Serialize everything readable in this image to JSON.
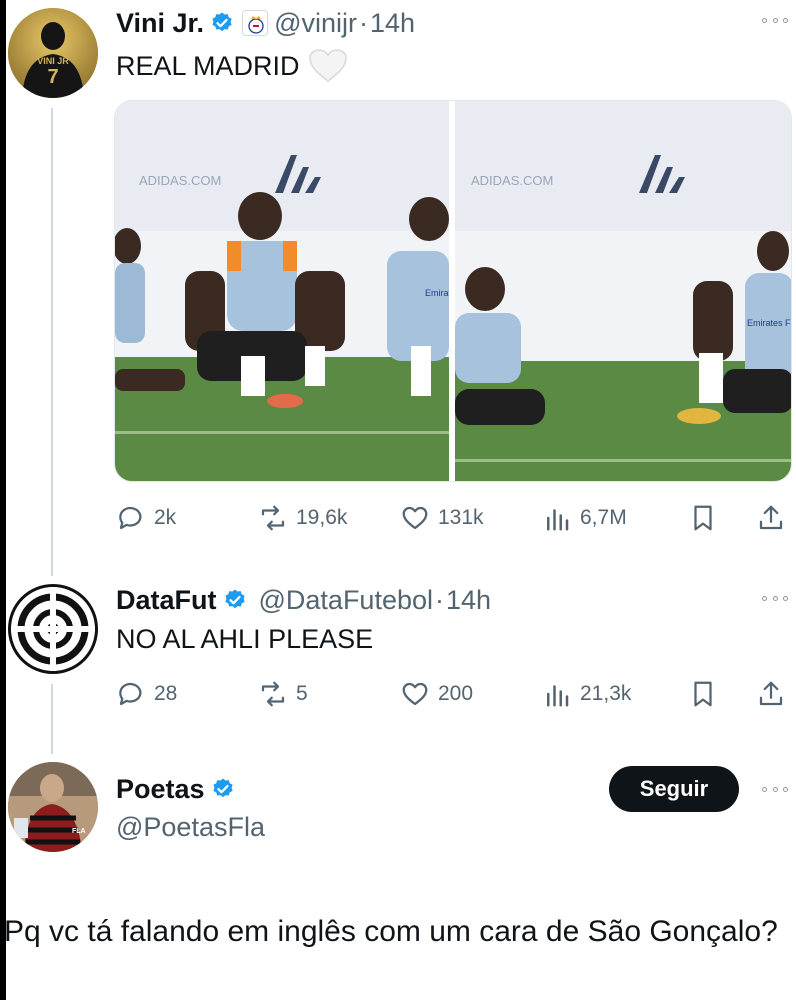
{
  "tweets": [
    {
      "name": "Vini Jr.",
      "handle": "@vinijr",
      "dot": "·",
      "time": "14h",
      "avatar_label": "VINI JR",
      "avatar_number": "7",
      "text": "REAL MADRID",
      "emoji": "white-heart",
      "photos": [
        {
          "banner": "ADIDAS.COM",
          "shirt_text": "Emirates FLY BETTER"
        },
        {
          "banner": "ADIDAS.COM",
          "shirt_text": "Emirates FLY BETTER"
        }
      ],
      "stats": {
        "replies": "2k",
        "reposts": "19,6k",
        "likes": "131k",
        "views": "6,7M"
      }
    },
    {
      "name": "DataFut",
      "handle": "@DataFutebol",
      "dot": "·",
      "time": "14h",
      "text": "NO AL AHLI PLEASE",
      "stats": {
        "replies": "28",
        "reposts": "5",
        "likes": "200",
        "views": "21,3k"
      }
    },
    {
      "name": "Poetas",
      "handle": "@PoetasFla",
      "follow_label": "Seguir",
      "avatar_label": "FLA"
    }
  ],
  "caption": "Pq vc tá falando em inglês com um cara de São Gonçalo?",
  "colors": {
    "verified": "#1d9bf0",
    "text": "#0f1419",
    "muted": "#536471",
    "grass": "#4f7a3a"
  }
}
